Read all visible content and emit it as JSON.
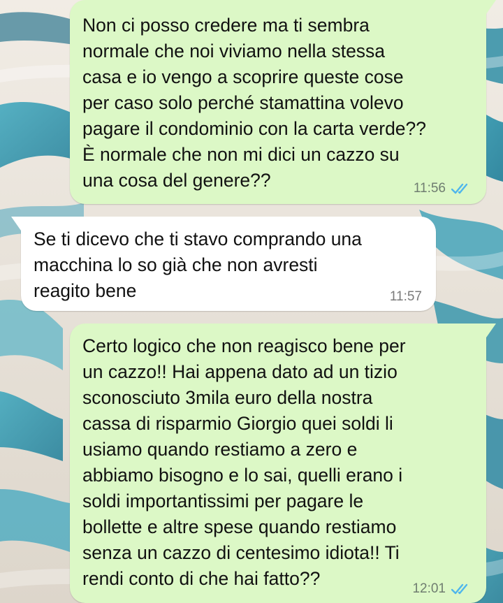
{
  "messages": [
    {
      "direction": "outgoing",
      "text": "Non ci posso credere ma ti sembra\nnormale che noi viviamo nella stessa\ncasa e io vengo a scoprire queste cose\nper caso solo perché stamattina volevo\npagare il condominio con la carta verde??\nÈ normale che non mi dici un cazzo su\nuna cosa del genere??",
      "time": "11:56",
      "status_icon": "read-double-check-icon"
    },
    {
      "direction": "incoming",
      "text": "Se ti dicevo che ti stavo comprando una\nmacchina lo so già che non avresti\nreagito bene",
      "time": "11:57"
    },
    {
      "direction": "outgoing",
      "text": "Certo logico che non reagisco bene per\nun cazzo!! Hai appena dato ad un tizio\nsconosciuto 3mila euro della nostra\ncassa di risparmio Giorgio quei soldi li\nusiamo quando restiamo a zero e\nabbiamo bisogno e lo sai, quelli erano i\nsoldi importantissimi per pagare le\nbollette e altre spese quando restiamo\nsenza un cazzo di centesimo idiota!! Ti\nrendi conto di che hai fatto??",
      "time": "12:01",
      "status_icon": "read-double-check-icon"
    }
  ],
  "colors": {
    "outgoing_bubble": "#dcf8c6",
    "incoming_bubble": "#ffffff",
    "read_ticks": "#4fb6ec",
    "wallpaper_sand": "#ece7df",
    "wallpaper_lagoon": "#2a8fa8"
  }
}
